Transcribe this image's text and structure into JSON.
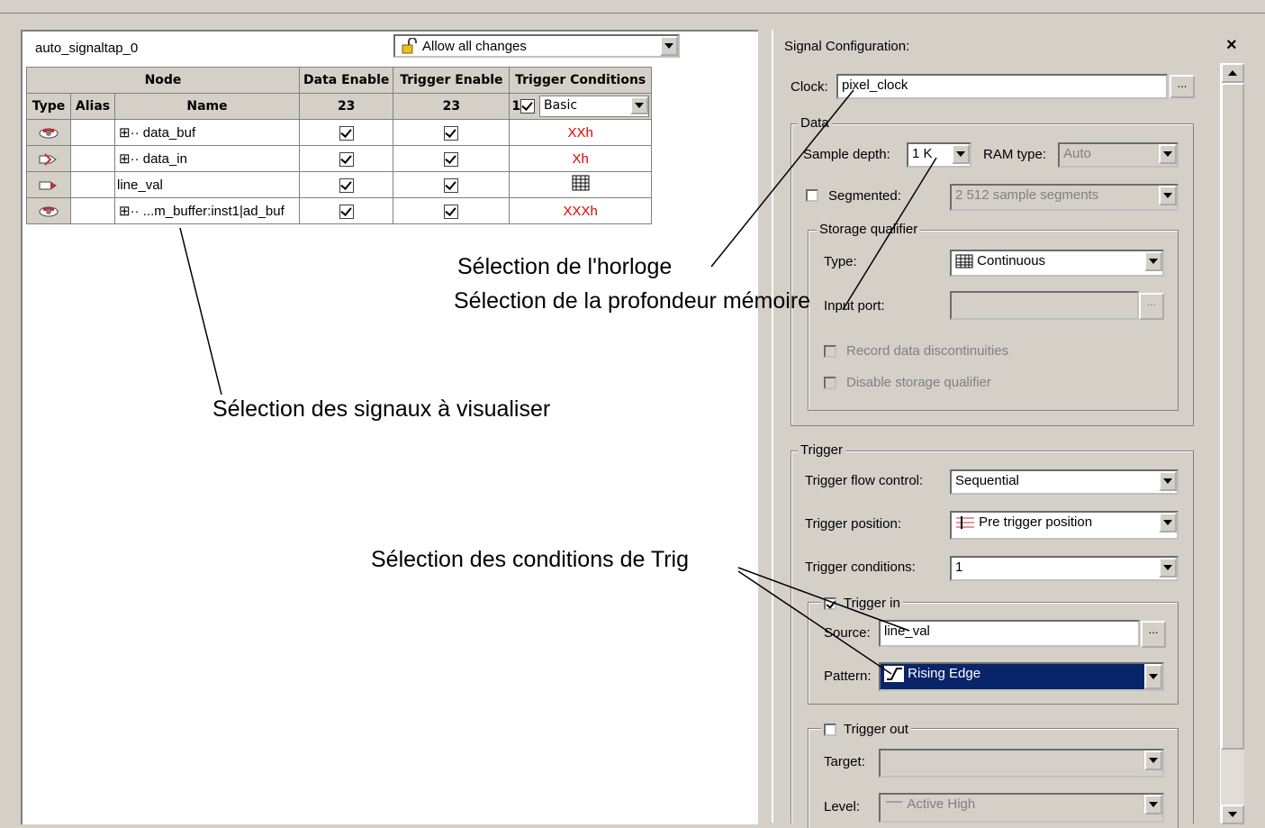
{
  "instance": {
    "name": "auto_signaltap_0",
    "changes_option": "Allow all changes"
  },
  "table": {
    "header_node": "Node",
    "header_data_enable": "Data Enable",
    "header_trigger_enable": "Trigger Enable",
    "header_trigger_conditions": "Trigger Conditions",
    "col_type": "Type",
    "col_alias": "Alias",
    "col_name": "Name",
    "data_enable_count": "23",
    "trigger_enable_count": "23",
    "condition_index": "1",
    "condition_mode": "Basic",
    "rows": [
      {
        "name": "data_buf",
        "tree": "⊞··",
        "cond": "XXh"
      },
      {
        "name": "data_in",
        "tree": "⊞··",
        "cond": "Xh"
      },
      {
        "name": "line_val",
        "tree": "",
        "cond": ""
      },
      {
        "name": "...m_buffer:inst1|ad_buf",
        "tree": "⊞··",
        "cond": "XXXh"
      }
    ]
  },
  "signal_config": {
    "title": "Signal Configuration:",
    "close": "×",
    "clock_label": "Clock:",
    "clock_value": "pixel_clock",
    "browse": "...",
    "data_group": "Data",
    "sample_depth_label": "Sample depth:",
    "sample_depth_value": "1 K",
    "ram_type_label": "RAM type:",
    "ram_type_value": "Auto",
    "segmented_label": "Segmented:",
    "segmented_value": "2  512 sample segments",
    "storage_group": "Storage qualifier",
    "sq_type_label": "Type:",
    "sq_type_value": "Continuous",
    "input_port_label": "Input port:",
    "record_disc": "Record data discontinuities",
    "disable_sq": "Disable storage qualifier",
    "trigger_group": "Trigger",
    "flow_label": "Trigger flow control:",
    "flow_value": "Sequential",
    "position_label": "Trigger position:",
    "position_value": "Pre trigger position",
    "conditions_label": "Trigger conditions:",
    "conditions_value": "1",
    "trigger_in_label": "Trigger in",
    "source_label": "Source:",
    "source_value": "line_val",
    "pattern_label": "Pattern:",
    "pattern_value": "Rising Edge",
    "trigger_out_label": "Trigger out",
    "target_label": "Target:",
    "level_label": "Level:",
    "level_value": "Active High"
  },
  "annotations": {
    "clock": "Sélection de l'horloge",
    "depth": "Sélection de la profondeur mémoire",
    "signals": "Sélection des signaux à visualiser",
    "trig": "Sélection des conditions de Trig"
  }
}
